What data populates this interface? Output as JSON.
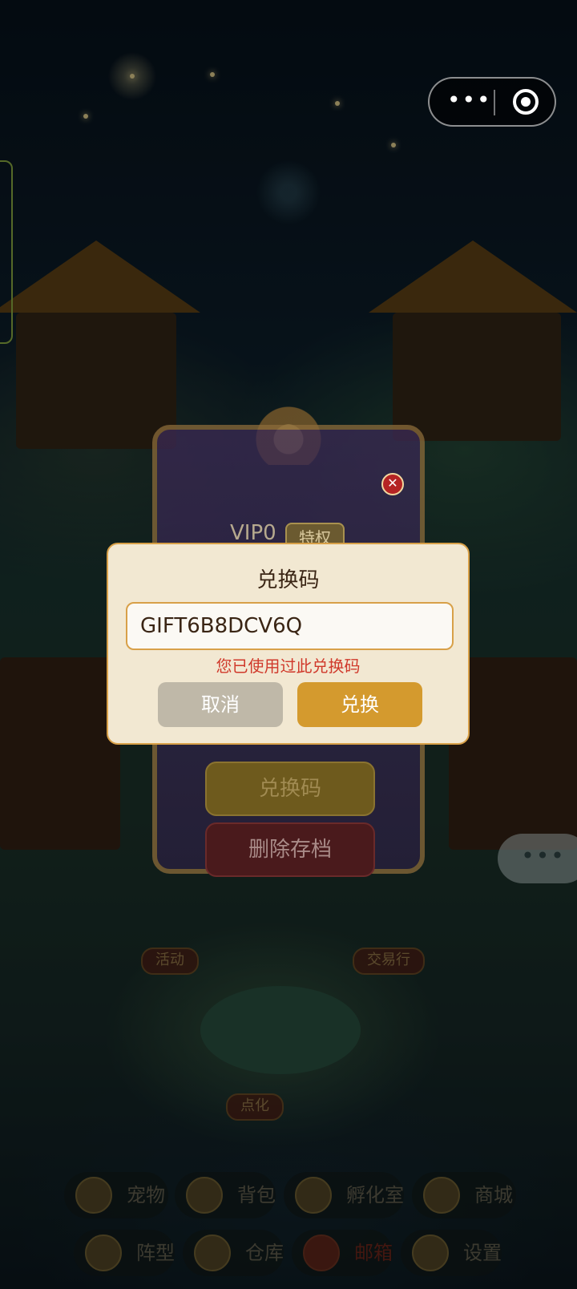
{
  "capsule": {
    "more_icon": "more-dots-icon",
    "target_icon": "target-close-icon",
    "more_glyph": "•••"
  },
  "vip_panel": {
    "vip_level": "VIP0",
    "badge": "特权",
    "redeem_button": "兑换码",
    "delete_button": "删除存档",
    "close_icon": "close-icon"
  },
  "chat": {
    "glyph": "•••"
  },
  "map_labels": {
    "activity": "活动",
    "trade": "交易行",
    "enlighten": "点化"
  },
  "bottom_menu": {
    "row1": [
      "宠物",
      "背包",
      "孵化室",
      "商城"
    ],
    "row2": [
      "阵型",
      "仓库",
      "邮箱",
      "设置"
    ]
  },
  "dialog": {
    "title": "兑换码",
    "code_value": "GIFT6B8DCV6Q",
    "error": "您已使用过此兑换码",
    "cancel": "取消",
    "confirm": "兑换"
  },
  "colors": {
    "accent_gold": "#d49a2e",
    "error_red": "#d0392b",
    "dialog_bg": "#f2e8d2"
  }
}
